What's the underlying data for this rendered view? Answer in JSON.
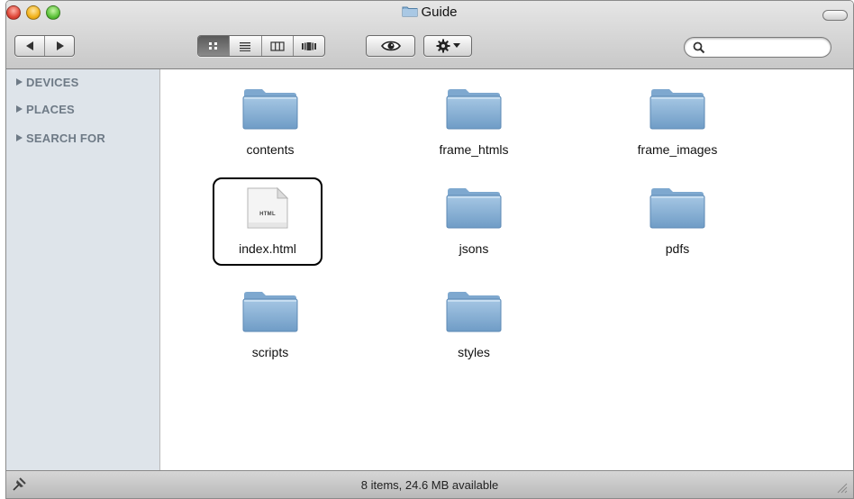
{
  "window": {
    "title": "Guide"
  },
  "toolbar": {
    "view_modes": [
      "icon-view",
      "list-view",
      "column-view",
      "cover-flow-view"
    ],
    "active_view": "icon-view",
    "search": {
      "placeholder": "",
      "value": ""
    }
  },
  "sidebar": {
    "sections": [
      {
        "label": "DEVICES"
      },
      {
        "label": "PLACES"
      },
      {
        "label": "SEARCH FOR"
      }
    ]
  },
  "items": [
    {
      "name": "contents",
      "kind": "folder"
    },
    {
      "name": "frame_htmls",
      "kind": "folder"
    },
    {
      "name": "frame_images",
      "kind": "folder"
    },
    {
      "name": "index.html",
      "kind": "html-file",
      "badge": "HTML",
      "highlighted": true
    },
    {
      "name": "jsons",
      "kind": "folder"
    },
    {
      "name": "pdfs",
      "kind": "folder"
    },
    {
      "name": "scripts",
      "kind": "folder"
    },
    {
      "name": "styles",
      "kind": "folder"
    }
  ],
  "statusbar": {
    "text": "8 items, 24.6 MB available"
  },
  "colors": {
    "sidebar_bg": "#dee4ea",
    "folder_blue": "#8cb4d6",
    "highlight_border": "#000000"
  }
}
